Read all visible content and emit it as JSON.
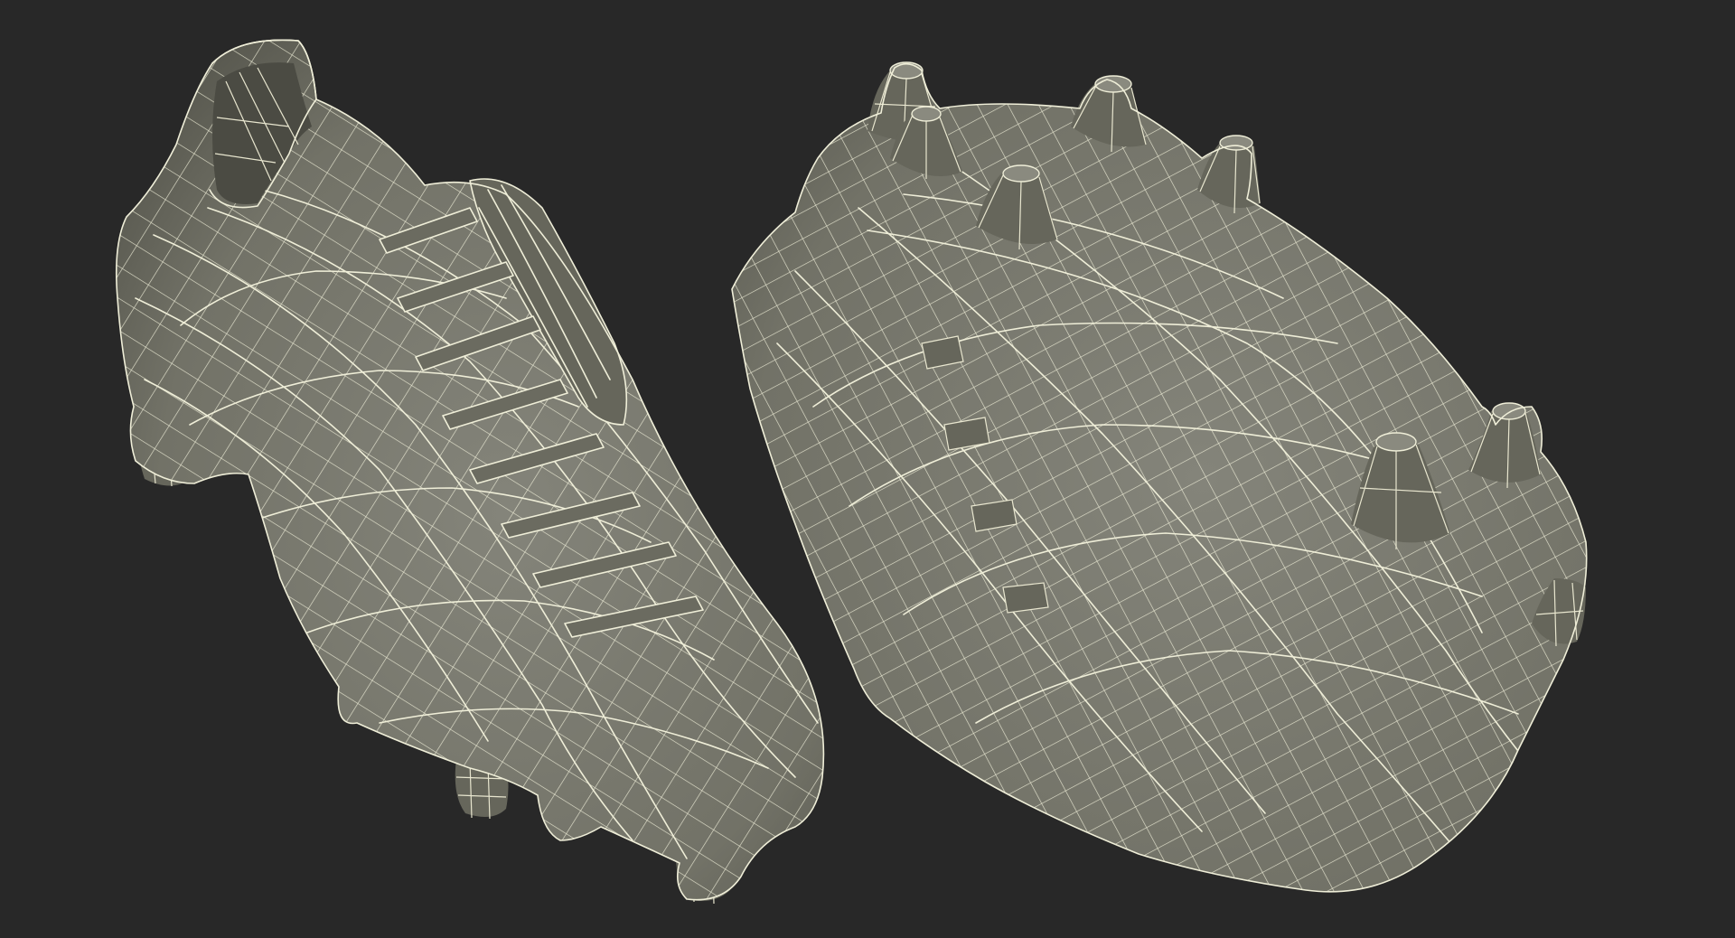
{
  "scene": {
    "background_color": "#282828",
    "mesh_fill_color": "#7a7a6d",
    "wireframe_color": "#efeed8",
    "objects": [
      {
        "name": "football-boot-top-view",
        "view": "top",
        "cleats_visible": 3
      },
      {
        "name": "football-boot-bottom-view",
        "view": "bottom",
        "cleats_visible": 8
      }
    ]
  }
}
